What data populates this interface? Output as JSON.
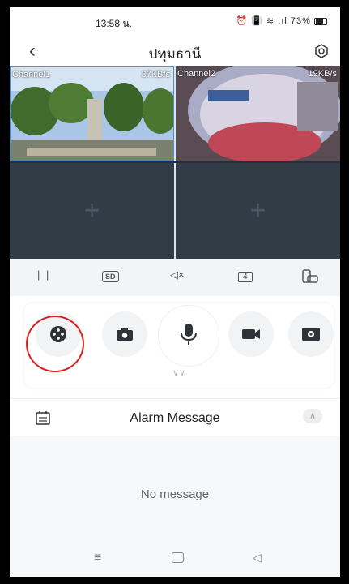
{
  "status_bar": {
    "time": "13:58 น.",
    "icons": "⏰ 📳 ≋ .ıl",
    "battery": "73%"
  },
  "header": {
    "title": "ปทุมธานี"
  },
  "channels": [
    {
      "label": "Channel1",
      "rate": "37KB/s"
    },
    {
      "label": "Channel2",
      "rate": "19KB/s"
    }
  ],
  "toolbar": {
    "pause": "| |",
    "quality": "SD",
    "volume": "◁×",
    "layout": "4"
  },
  "alarm": {
    "title": "Alarm Message",
    "empty_text": "No message"
  },
  "colors": {
    "accent_highlight": "#d92020",
    "video_bg": "#333d48"
  }
}
